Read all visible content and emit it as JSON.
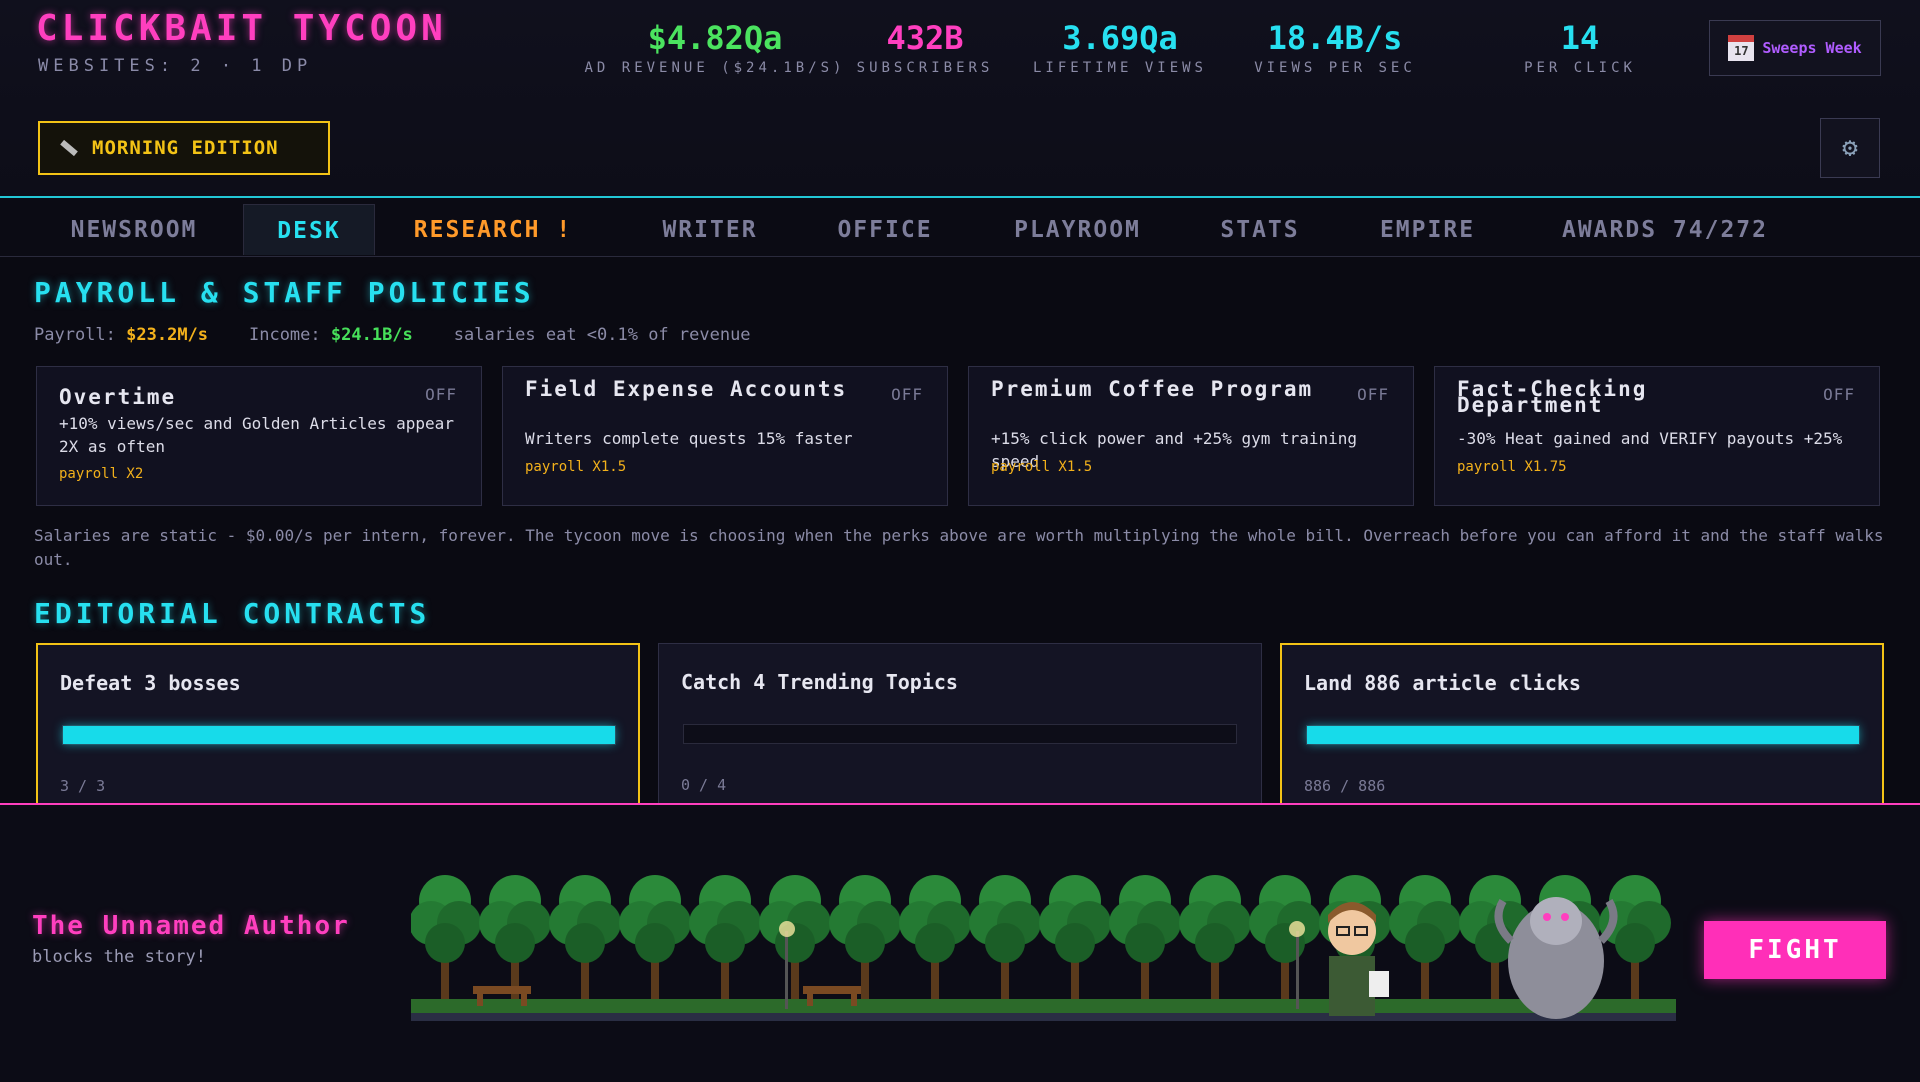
{
  "header": {
    "title": "CLICKBAIT TYCOON",
    "websites": "WEBSITES: 2 · 1 DP",
    "stats": [
      {
        "value": "$4.82Qa",
        "label": "AD REVENUE ($24.1B/S)",
        "color": "#4be35f"
      },
      {
        "value": "432B",
        "label": "SUBSCRIBERS",
        "color": "#ff3fbf"
      },
      {
        "value": "3.69Qa",
        "label": "LIFETIME VIEWS",
        "color": "#27e0f0"
      },
      {
        "value": "18.4B/s",
        "label": "VIEWS PER SEC",
        "color": "#27e0f0"
      },
      {
        "value": "14",
        "label": "PER CLICK",
        "color": "#27e0f0"
      }
    ],
    "sweeps_label": "Sweeps Week",
    "calendar_day": "17",
    "edition_label": "MORNING EDITION"
  },
  "tabs": [
    {
      "label": "NEWSROOM"
    },
    {
      "label": "DESK",
      "active": true
    },
    {
      "label": "RESEARCH !",
      "alert": true
    },
    {
      "label": "WRITER"
    },
    {
      "label": "OFFICE"
    },
    {
      "label": "PLAYROOM"
    },
    {
      "label": "STATS"
    },
    {
      "label": "EMPIRE"
    },
    {
      "label": "AWARDS 74/272"
    }
  ],
  "payroll": {
    "title": "PAYROLL & STAFF POLICIES",
    "payroll_label": "Payroll:",
    "payroll_value": "$23.2M/s",
    "income_label": "Income:",
    "income_value": "$24.1B/s",
    "ratio_text": "salaries eat <0.1% of revenue",
    "policies": [
      {
        "name": "Overtime",
        "status": "OFF",
        "desc": "+10% views/sec and Golden Articles appear 2X as often",
        "mult": "payroll X2"
      },
      {
        "name": "Field Expense Accounts",
        "status": "OFF",
        "desc": "Writers complete quests 15% faster",
        "mult": "payroll X1.5"
      },
      {
        "name": "Premium Coffee Program",
        "status": "OFF",
        "desc": "+15% click power and +25% gym training speed",
        "mult": "payroll X1.5"
      },
      {
        "name": "Fact-Checking Department",
        "status": "OFF",
        "desc": "-30% Heat gained and VERIFY payouts +25%",
        "mult": "payroll X1.75"
      }
    ],
    "note": "Salaries are static - $0.00/s per intern, forever. The tycoon move is choosing when the perks above are worth multiplying the whole bill. Overreach before you can afford it and the staff walks out."
  },
  "contracts": {
    "title": "EDITORIAL CONTRACTS",
    "items": [
      {
        "title": "Defeat 3 bosses",
        "progress_text": "3 / 3",
        "progress": 1.0,
        "complete": true
      },
      {
        "title": "Catch 4 Trending Topics",
        "progress_text": "0 / 4",
        "progress": 0.0,
        "complete": false
      },
      {
        "title": "Land 886 article clicks",
        "progress_text": "886 / 886",
        "progress": 1.0,
        "complete": true
      }
    ]
  },
  "boss": {
    "name": "The Unnamed Author",
    "subtitle": "blocks the story!",
    "fight_label": "FIGHT"
  }
}
